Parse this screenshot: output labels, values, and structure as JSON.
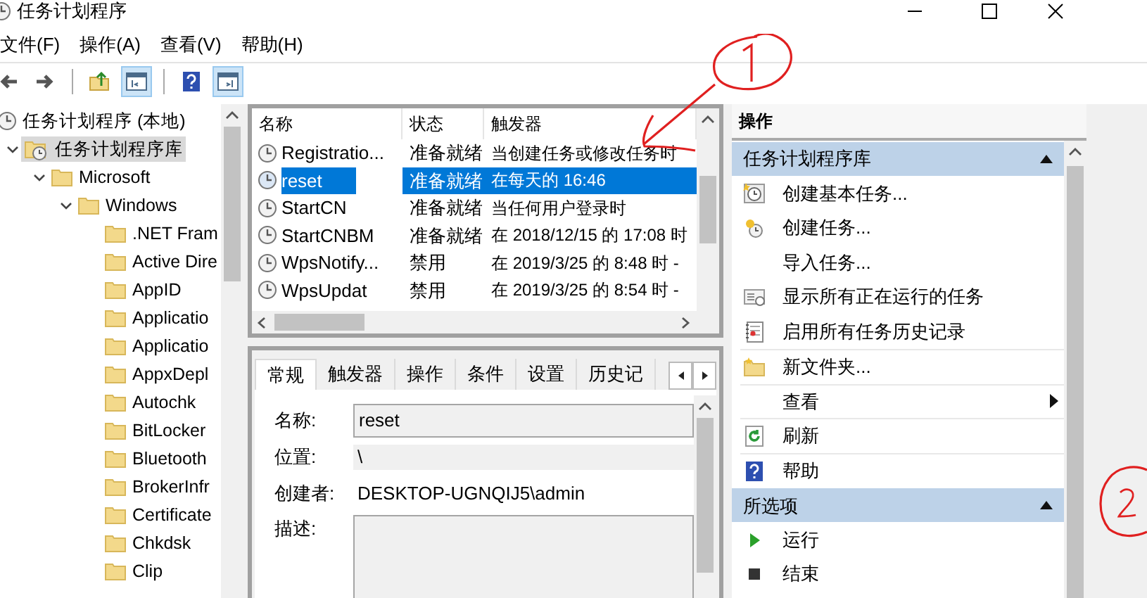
{
  "window": {
    "title": "任务计划程序"
  },
  "menu": [
    {
      "label": "文件(F)"
    },
    {
      "label": "操作(A)"
    },
    {
      "label": "查看(V)"
    },
    {
      "label": "帮助(H)"
    }
  ],
  "toolbar": [
    {
      "kind": "back"
    },
    {
      "kind": "forward"
    },
    {
      "kind": "separator"
    },
    {
      "kind": "up"
    },
    {
      "kind": "pane",
      "selected": true
    },
    {
      "kind": "separator"
    },
    {
      "kind": "help"
    },
    {
      "kind": "pane2",
      "selected": true
    }
  ],
  "tree": {
    "items": [
      {
        "label": "任务计划程序 (本地)",
        "kind": "root",
        "selected": false,
        "children": [
          {
            "label": "任务计划程序库",
            "kind": "library",
            "selected": true,
            "expanded": true,
            "children": [
              {
                "label": "Microsoft",
                "kind": "folder",
                "selected": false,
                "expanded": true,
                "children": [
                  {
                    "label": "Windows",
                    "kind": "folder",
                    "selected": false,
                    "expanded": true,
                    "children": [
                      {
                        "label": ".NET Fram",
                        "kind": "folder",
                        "selected": false
                      },
                      {
                        "label": "Active Dire",
                        "kind": "folder",
                        "selected": false
                      },
                      {
                        "label": "AppID",
                        "kind": "folder",
                        "selected": false
                      },
                      {
                        "label": "Applicatio",
                        "kind": "folder",
                        "selected": false
                      },
                      {
                        "label": "Applicatio",
                        "kind": "folder",
                        "selected": false
                      },
                      {
                        "label": "AppxDepl",
                        "kind": "folder",
                        "selected": false
                      },
                      {
                        "label": "Autochk",
                        "kind": "folder",
                        "selected": false
                      },
                      {
                        "label": "BitLocker",
                        "kind": "folder",
                        "selected": false
                      },
                      {
                        "label": "Bluetooth",
                        "kind": "folder",
                        "selected": false
                      },
                      {
                        "label": "BrokerInfr",
                        "kind": "folder",
                        "selected": false
                      },
                      {
                        "label": "Certificate",
                        "kind": "folder",
                        "selected": false
                      },
                      {
                        "label": "Chkdsk",
                        "kind": "folder",
                        "selected": false
                      },
                      {
                        "label": "Clip",
                        "kind": "folder",
                        "selected": false
                      }
                    ]
                  }
                ]
              }
            ]
          }
        ]
      }
    ]
  },
  "tasks": {
    "columns": [
      "名称",
      "状态",
      "触发器"
    ],
    "rows": [
      {
        "name": "Registratio...",
        "status": "准备就绪",
        "trigger": "当创建任务或修改任务时",
        "selected": false
      },
      {
        "name": "reset",
        "status": "准备就绪",
        "trigger": "在每天的 16:46",
        "selected": true
      },
      {
        "name": "StartCN",
        "status": "准备就绪",
        "trigger": "当任何用户登录时",
        "selected": false
      },
      {
        "name": "StartCNBM",
        "status": "准备就绪",
        "trigger": "在 2018/12/15 的 17:08 时",
        "selected": false
      },
      {
        "name": "WpsNotify...",
        "status": "禁用",
        "trigger": "在 2019/3/25 的 8:48 时 -",
        "selected": false
      },
      {
        "name": "WpsUpdat",
        "status": "禁用",
        "trigger": "在 2019/3/25 的 8:54 时 -",
        "selected": false
      }
    ]
  },
  "details": {
    "tabs": [
      {
        "label": "常规",
        "selected": true
      },
      {
        "label": "触发器",
        "selected": false
      },
      {
        "label": "操作",
        "selected": false
      },
      {
        "label": "条件",
        "selected": false
      },
      {
        "label": "设置",
        "selected": false
      },
      {
        "label": "历史记",
        "selected": false
      }
    ],
    "fields": [
      {
        "label": "名称:",
        "kind": "input",
        "value": "reset"
      },
      {
        "label": "位置:",
        "kind": "readonly",
        "value": "\\"
      },
      {
        "label": "创建者:",
        "kind": "text",
        "value": "DESKTOP-UGNQIJ5\\admin"
      },
      {
        "label": "描述:",
        "kind": "textarea"
      }
    ]
  },
  "actions": {
    "title": "操作",
    "sections": [
      {
        "title": "任务计划程序库",
        "expanded": true,
        "items": [
          {
            "label": "创建基本任务...",
            "kind": "create-basic"
          },
          {
            "label": "创建任务...",
            "kind": "create"
          },
          {
            "label": "导入任务...",
            "kind": "plain"
          },
          {
            "label": "显示所有正在运行的任务",
            "kind": "running"
          },
          {
            "label": "启用所有任务历史记录",
            "kind": "history"
          },
          {
            "label": "新文件夹...",
            "kind": "new-folder"
          },
          {
            "label": "查看",
            "kind": "plain",
            "submenu": true
          },
          {
            "label": "刷新",
            "kind": "refresh"
          },
          {
            "label": "帮助",
            "kind": "help"
          }
        ]
      },
      {
        "title": "所选项",
        "expanded": true,
        "items": [
          {
            "label": "运行",
            "kind": "run"
          },
          {
            "label": "结束",
            "kind": "stop"
          }
        ]
      }
    ]
  }
}
